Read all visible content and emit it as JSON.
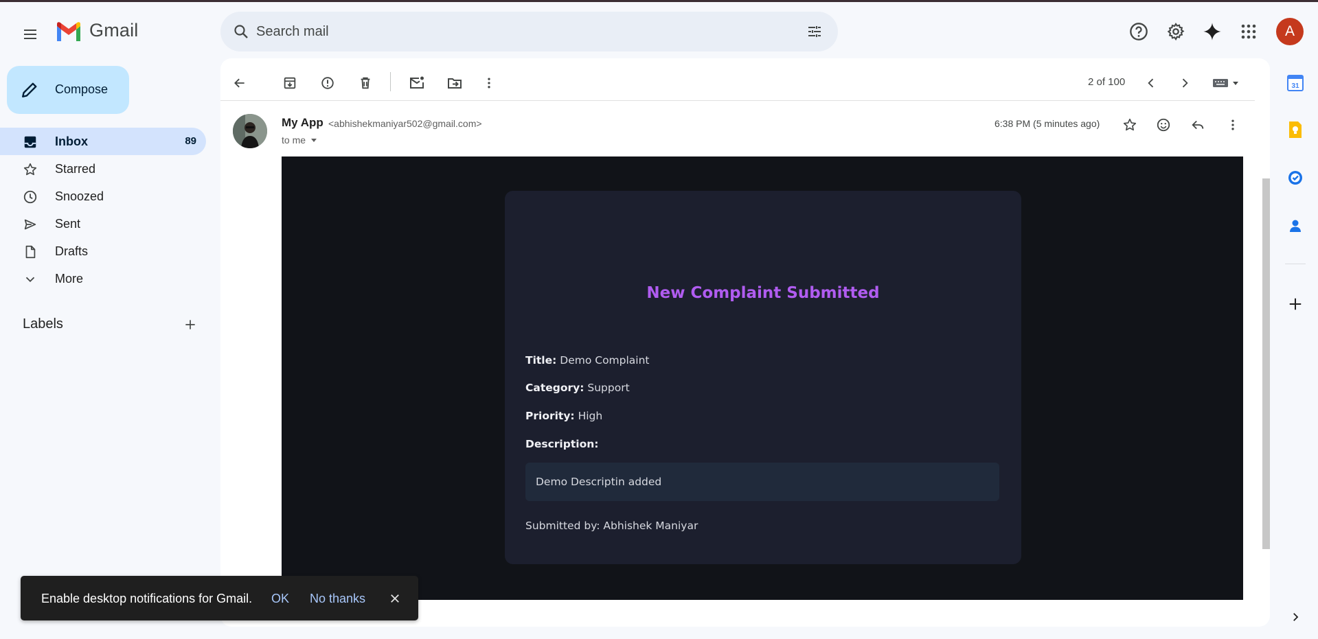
{
  "header": {
    "app_name": "Gmail",
    "search_placeholder": "Search mail",
    "account_initial": "A"
  },
  "compose": {
    "label": "Compose"
  },
  "nav": {
    "items": [
      {
        "label": "Inbox",
        "count": "89",
        "icon": "inbox-icon",
        "active": true
      },
      {
        "label": "Starred",
        "icon": "star-icon"
      },
      {
        "label": "Snoozed",
        "icon": "clock-icon"
      },
      {
        "label": "Sent",
        "icon": "send-icon"
      },
      {
        "label": "Drafts",
        "icon": "draft-icon"
      },
      {
        "label": "More",
        "icon": "chevron-down-icon"
      }
    ],
    "labels_heading": "Labels"
  },
  "toolbar": {
    "pager": "2 of 100"
  },
  "message": {
    "sender_name": "My App",
    "sender_email": "<abhishekmaniyar502@gmail.com>",
    "recipient": "to me",
    "time": "6:38 PM (5 minutes ago)"
  },
  "email": {
    "heading": "New Complaint Submitted",
    "title_label": "Title:",
    "title_value": "Demo Complaint",
    "category_label": "Category:",
    "category_value": "Support",
    "priority_label": "Priority:",
    "priority_value": "High",
    "description_label": "Description:",
    "description_value": "Demo Descriptin added",
    "submitted_by": "Submitted by: Abhishek Maniyar"
  },
  "snackbar": {
    "message": "Enable desktop notifications for Gmail.",
    "ok": "OK",
    "no_thanks": "No thanks"
  },
  "side_panel": {
    "calendar_day": "31"
  },
  "colors": {
    "accent_purple": "#b05cf0",
    "compose_bg": "#c2e7ff",
    "active_nav_bg": "#d3e3fd",
    "avatar_bg": "#c5391d"
  }
}
